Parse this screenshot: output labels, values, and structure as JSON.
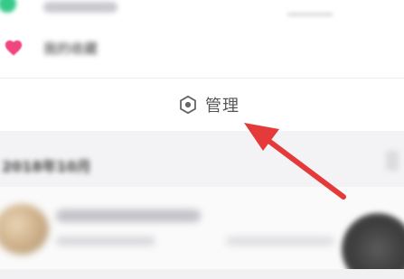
{
  "top_row": {
    "icon": "green-circle-icon"
  },
  "favorites_row": {
    "icon": "heart-icon",
    "label": "我的收藏",
    "icon_color": "#f0457d"
  },
  "manage_row": {
    "icon": "hexagon-gear-icon",
    "label": "管理",
    "label_color": "#555555"
  },
  "section": {
    "title": "2018年10月"
  },
  "annotation": {
    "type": "arrow",
    "color": "#e53a3a"
  }
}
